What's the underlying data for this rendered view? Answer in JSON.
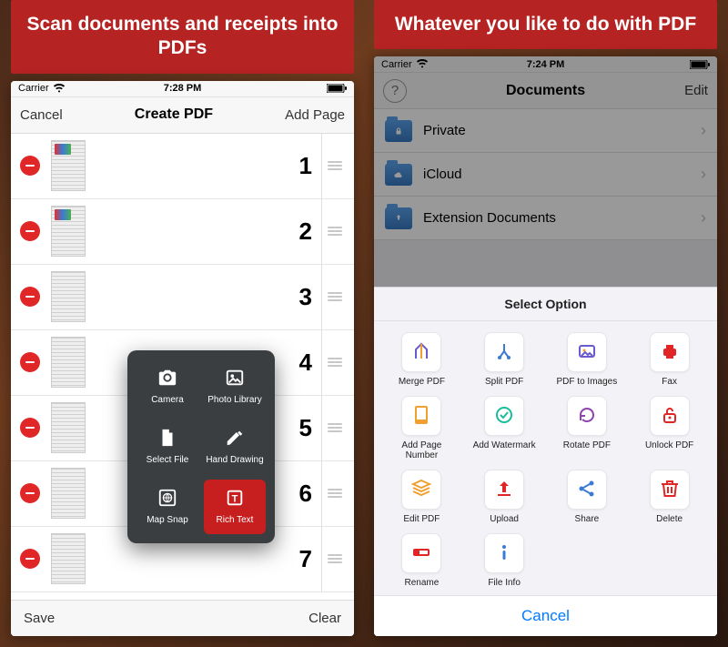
{
  "left": {
    "banner": "Scan documents and receipts into PDFs",
    "statusbar": {
      "carrier": "Carrier",
      "time": "7:28 PM"
    },
    "nav": {
      "cancel": "Cancel",
      "title": "Create PDF",
      "addPage": "Add Page"
    },
    "pages": [
      "1",
      "2",
      "3",
      "4",
      "5",
      "6",
      "7"
    ],
    "bottom": {
      "save": "Save",
      "clear": "Clear"
    },
    "popover": {
      "camera": "Camera",
      "photoLibrary": "Photo Library",
      "selectFile": "Select File",
      "handDrawing": "Hand Drawing",
      "mapSnap": "Map Snap",
      "richText": "Rich Text"
    }
  },
  "right": {
    "banner": "Whatever you like to do with PDF",
    "statusbar": {
      "carrier": "Carrier",
      "time": "7:24 PM"
    },
    "nav": {
      "title": "Documents",
      "edit": "Edit"
    },
    "folders": {
      "private": "Private",
      "icloud": "iCloud",
      "extension": "Extension Documents"
    },
    "sheet": {
      "title": "Select Option",
      "options": {
        "merge": "Merge PDF",
        "split": "Split PDF",
        "toImages": "PDF to Images",
        "fax": "Fax",
        "pageNumber": "Add Page Number",
        "watermark": "Add Watermark",
        "rotate": "Rotate PDF",
        "unlock": "Unlock PDF",
        "edit": "Edit PDF",
        "upload": "Upload",
        "share": "Share",
        "delete": "Delete",
        "rename": "Rename",
        "fileInfo": "File Info"
      },
      "cancel": "Cancel"
    }
  },
  "colors": {
    "red": "#c71f1f",
    "iosBlue": "#007aff",
    "bannerRed": "#b52323"
  }
}
